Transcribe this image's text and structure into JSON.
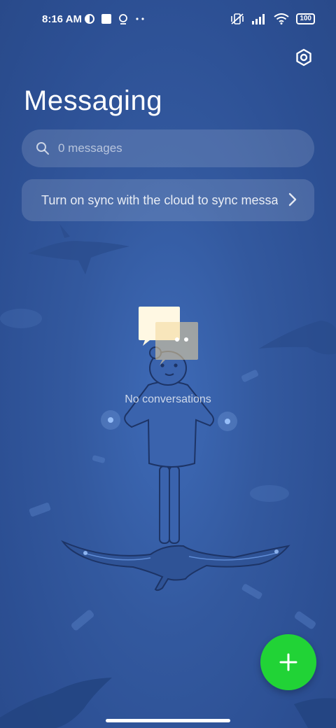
{
  "status_bar": {
    "time": "8:16 AM",
    "battery": "100"
  },
  "header": {
    "title": "Messaging"
  },
  "search": {
    "placeholder": "0 messages"
  },
  "sync_banner": {
    "text": "Turn on sync with the cloud to sync messages"
  },
  "empty_state": {
    "text": "No conversations"
  },
  "colors": {
    "fab": "#21d336",
    "background": "#33599f"
  },
  "icons": [
    "settings-icon",
    "search-icon",
    "chevron-right-icon",
    "plus-icon"
  ]
}
